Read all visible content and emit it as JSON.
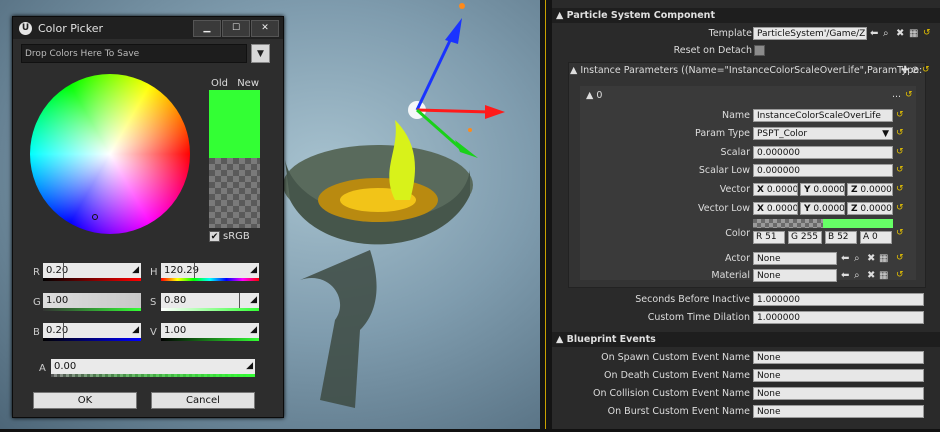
{
  "color_picker": {
    "title": "Color Picker",
    "window_buttons": [
      "▁",
      "☐",
      "✕"
    ],
    "drop_text": "Drop Colors Here To Save",
    "drop_arrow": "▼",
    "old_label": "Old",
    "new_label": "New",
    "new_color": "#33ff34",
    "srgb_label": "sRGB",
    "srgb_checked": "✔",
    "channels": {
      "r": {
        "label": "R",
        "value": "0.20"
      },
      "g": {
        "label": "G",
        "value": "1.00"
      },
      "b": {
        "label": "B",
        "value": "0.20"
      },
      "h": {
        "label": "H",
        "value": "120.29"
      },
      "s": {
        "label": "S",
        "value": "0.80"
      },
      "v": {
        "label": "V",
        "value": "1.00"
      },
      "a": {
        "label": "A",
        "value": "0.00"
      }
    },
    "ok_label": "OK",
    "cancel_label": "Cancel"
  },
  "details": {
    "section1": {
      "header": "Particle System Component",
      "template_label": "Template",
      "template_value": "ParticleSystem'/Game/Z",
      "reset_label": "Reset on Detach"
    },
    "instance_params": {
      "header": "Instance Parameters ((Name=\"InstanceColorScaleOverLife\",ParamType:",
      "index_label": "0",
      "more": "...",
      "name_label": "Name",
      "name_value": "InstanceColorScaleOverLife",
      "param_type_label": "Param Type",
      "param_type_value": "PSPT_Color",
      "scalar_label": "Scalar",
      "scalar_value": "0.000000",
      "scalar_low_label": "Scalar Low",
      "scalar_low_value": "0.000000",
      "vector_label": "Vector",
      "vector_x": "0.0000",
      "vector_y": "0.0000",
      "vector_z": "0.0000",
      "vector_low_label": "Vector Low",
      "vector_low_x": "0.0000",
      "vector_low_y": "0.0000",
      "vector_low_z": "0.0000",
      "x_label": "X",
      "y_label": "Y",
      "z_label": "Z",
      "color_label": "Color",
      "color_swatch": "#66ff66",
      "color_r": "51",
      "color_g": "255",
      "color_b": "52",
      "color_a": "0",
      "r_label": "R",
      "g_label": "G",
      "b_label": "B",
      "a_label": "A",
      "actor_label": "Actor",
      "actor_value": "None",
      "material_label": "Material",
      "material_value": "None"
    },
    "seconds_before_inactive_label": "Seconds Before Inactive",
    "seconds_before_inactive_value": "1.000000",
    "custom_time_dilation_label": "Custom Time Dilation",
    "custom_time_dilation_value": "1.000000",
    "blueprint_events": {
      "header": "Blueprint Events",
      "on_spawn_label": "On Spawn Custom Event Name",
      "on_spawn_value": "None",
      "on_death_label": "On Death Custom Event Name",
      "on_death_value": "None",
      "on_collision_label": "On Collision Custom Event Name",
      "on_collision_value": "None",
      "on_burst_label": "On Burst Custom Event Name",
      "on_burst_value": "None"
    },
    "icons": {
      "use_selected": "⬅",
      "browse": "⌕",
      "clear": "✖",
      "grid": "▦",
      "reset": "↺",
      "add": "✚",
      "clear_all": "⊘"
    }
  }
}
